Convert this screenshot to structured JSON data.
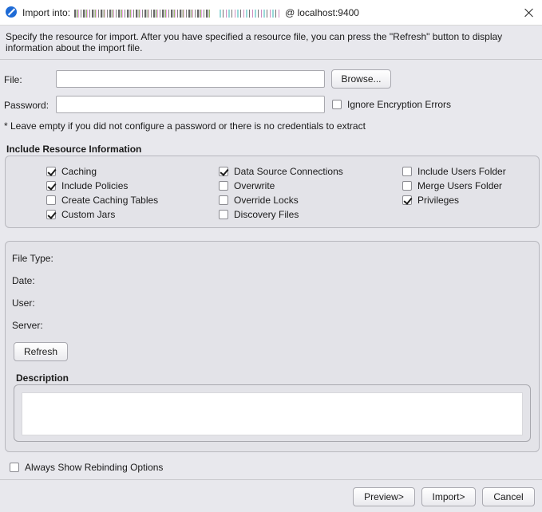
{
  "window": {
    "title_prefix": "Import into:",
    "title_suffix": "@ localhost:9400"
  },
  "intro_text": "Specify the resource for import. After you have specified a resource file, you can press the \"Refresh\" button to display information about the import file.",
  "file": {
    "label": "File:",
    "value": "",
    "browse_label": "Browse..."
  },
  "password": {
    "label": "Password:",
    "value": "",
    "ignore_label": "Ignore Encryption Errors",
    "ignore_checked": false
  },
  "password_note": "* Leave empty if you did not configure a password or there is no credentials to extract",
  "include_section": {
    "title": "Include Resource Information",
    "options": [
      {
        "label": "Caching",
        "checked": true
      },
      {
        "label": "Include Policies",
        "checked": true
      },
      {
        "label": "Create Caching Tables",
        "checked": false
      },
      {
        "label": "Custom Jars",
        "checked": true
      },
      {
        "label": "Data Source Connections",
        "checked": true
      },
      {
        "label": "Overwrite",
        "checked": false
      },
      {
        "label": "Override Locks",
        "checked": false
      },
      {
        "label": "Discovery Files",
        "checked": false
      },
      {
        "label": "Include Users Folder",
        "checked": false
      },
      {
        "label": "Merge Users Folder",
        "checked": false
      },
      {
        "label": "Privileges",
        "checked": true
      }
    ]
  },
  "info": {
    "file_type_label": "File Type:",
    "date_label": "Date:",
    "user_label": "User:",
    "server_label": "Server:",
    "refresh_label": "Refresh",
    "description_title": "Description",
    "description_value": ""
  },
  "rebinding": {
    "label": "Always Show Rebinding Options",
    "checked": false
  },
  "footer": {
    "preview_label": "Preview>",
    "import_label": "Import>",
    "cancel_label": "Cancel"
  }
}
